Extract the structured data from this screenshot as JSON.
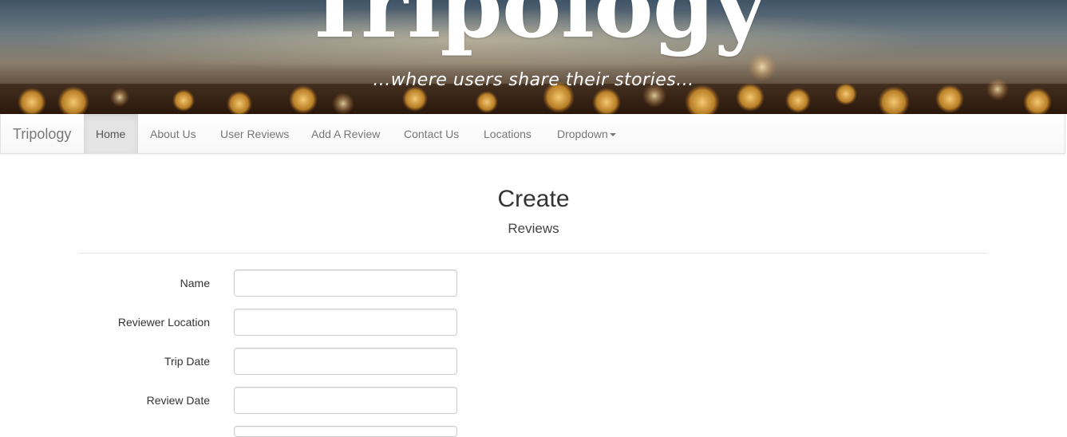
{
  "banner": {
    "title": "Tripology",
    "tagline": "...where users share their stories..."
  },
  "navbar": {
    "brand": "Tripology",
    "items": [
      {
        "label": "Home",
        "active": true
      },
      {
        "label": "About Us",
        "active": false
      },
      {
        "label": "User Reviews",
        "active": false
      },
      {
        "label": "Add A Review",
        "active": false
      },
      {
        "label": "Contact Us",
        "active": false
      },
      {
        "label": "Locations",
        "active": false
      },
      {
        "label": "Dropdown",
        "active": false
      }
    ]
  },
  "page": {
    "title": "Create",
    "subtitle": "Reviews"
  },
  "form": {
    "fields": [
      {
        "label": "Name",
        "value": ""
      },
      {
        "label": "Reviewer Location",
        "value": ""
      },
      {
        "label": "Trip Date",
        "value": ""
      },
      {
        "label": "Review Date",
        "value": ""
      }
    ]
  },
  "colors": {
    "navbar_bg": "#f8f8f8",
    "nav_active_bg": "#e4e4e4",
    "nav_text": "#777777"
  }
}
